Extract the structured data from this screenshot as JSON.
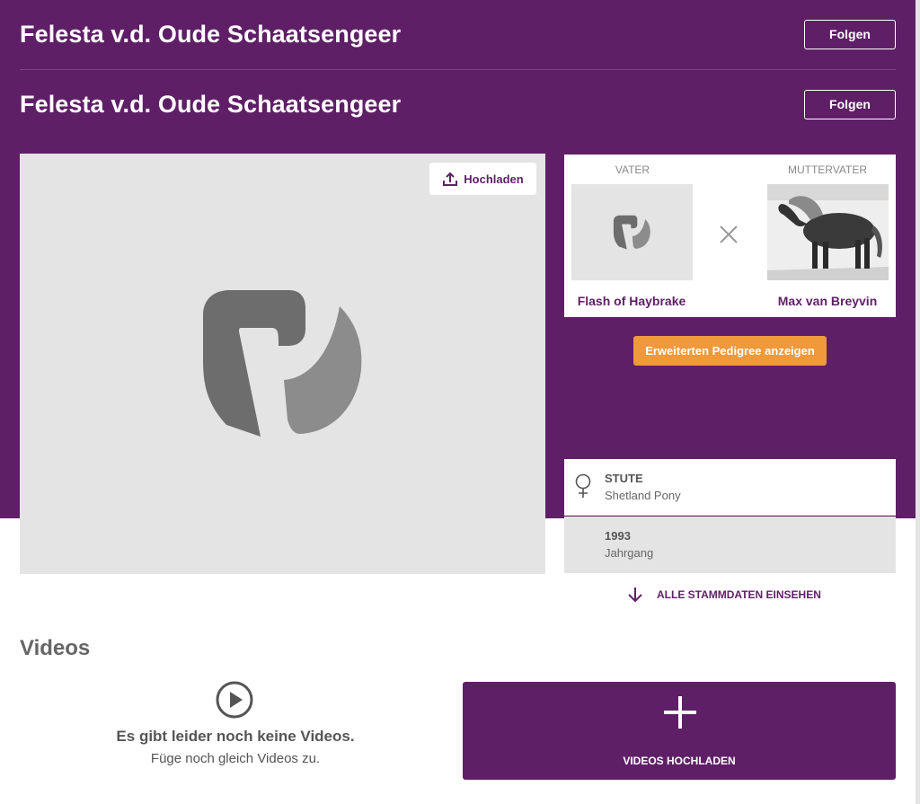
{
  "header": {
    "title_top": "Felesta v.d. Oude Schaatsengeer",
    "follow_top": "Folgen",
    "title_main": "Felesta v.d. Oude Schaatsengeer",
    "follow_main": "Folgen"
  },
  "photo": {
    "upload_label": "Hochladen"
  },
  "pedigree": {
    "father_label": "VATER",
    "father_name": "Flash of Haybrake",
    "mother_father_label": "MUTTERVATER",
    "mother_father_name": "Max van Breyvin",
    "extended_button": "Erweiterten Pedigree anzeigen"
  },
  "master_data": {
    "gender_title": "STUTE",
    "breed": "Shetland Pony",
    "year": "1993",
    "year_label": "Jahrgang",
    "all_data_link": "ALLE STAMMDATEN EINSEHEN"
  },
  "videos": {
    "section_title": "Videos",
    "empty_title": "Es gibt leider noch keine Videos.",
    "empty_sub": "Füge noch gleich Videos zu.",
    "upload_label": "VIDEOS HOCHLADEN"
  },
  "colors": {
    "brand_purple": "#5f1f67",
    "accent_orange": "#f0993b",
    "placeholder_gray": "#e4e4e4"
  }
}
